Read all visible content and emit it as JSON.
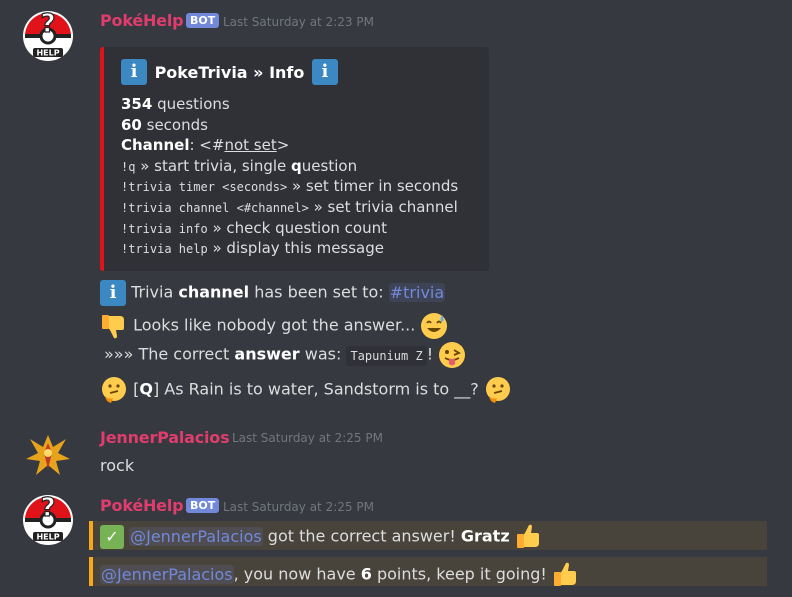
{
  "messages": [
    {
      "username": "PokéHelp",
      "bot_tag": "BOT",
      "timestamp": "Last Saturday at 2:23 PM",
      "embed": {
        "title": "PokeTrivia » Info",
        "questions_count": "354",
        "questions_label": " questions",
        "seconds_count": "60",
        "seconds_label": " seconds",
        "channel_label": "Channel",
        "channel_value_prefix": ": <#",
        "channel_value": "not set",
        "channel_value_suffix": ">",
        "commands": [
          {
            "cmd": "!q",
            "desc_pre": " » start trivia, single ",
            "desc_bold": "q",
            "desc_post": "uestion"
          },
          {
            "cmd": "!trivia timer <seconds>",
            "desc_pre": " » set timer in seconds",
            "desc_bold": "",
            "desc_post": ""
          },
          {
            "cmd": "!trivia channel <#channel>",
            "desc_pre": " » set trivia channel",
            "desc_bold": "",
            "desc_post": ""
          },
          {
            "cmd": "!trivia info",
            "desc_pre": " » check question count",
            "desc_bold": "",
            "desc_post": ""
          },
          {
            "cmd": "!trivia help",
            "desc_pre": " » display this message",
            "desc_bold": "",
            "desc_post": ""
          }
        ]
      },
      "lines": {
        "channel_set_pre": "Trivia ",
        "channel_set_bold": "channel",
        "channel_set_post": " has been set to: ",
        "channel_mention": "#trivia",
        "nobody": "Looks like nobody got the answer...",
        "correct_pre": "»»» The correct ",
        "correct_bold": "answer",
        "correct_post": " was: ",
        "correct_code": "Tapunium Z",
        "correct_end": "!",
        "q_pre": "[",
        "q_bold": "Q",
        "q_post": "] As Rain is to water, Sandstorm is to __?"
      }
    },
    {
      "username": "JennerPalacios",
      "timestamp": "Last Saturday at 2:25 PM",
      "text": "rock"
    },
    {
      "username": "PokéHelp",
      "bot_tag": "BOT",
      "timestamp": "Last Saturday at 2:25 PM",
      "line1_mention": "@JennerPalacios",
      "line1_text": " got the correct answer! ",
      "line1_bold": "Gratz",
      "line2_mention": "@JennerPalacios",
      "line2_pre": ", you now have ",
      "line2_bold": "6",
      "line2_post": " points, keep it going!"
    }
  ],
  "colors": {
    "background": "#36393f",
    "embed_bar": "#e0121a",
    "username": "#e03c6e",
    "mention": "#7289da",
    "highlight_bar": "#faa61a"
  }
}
